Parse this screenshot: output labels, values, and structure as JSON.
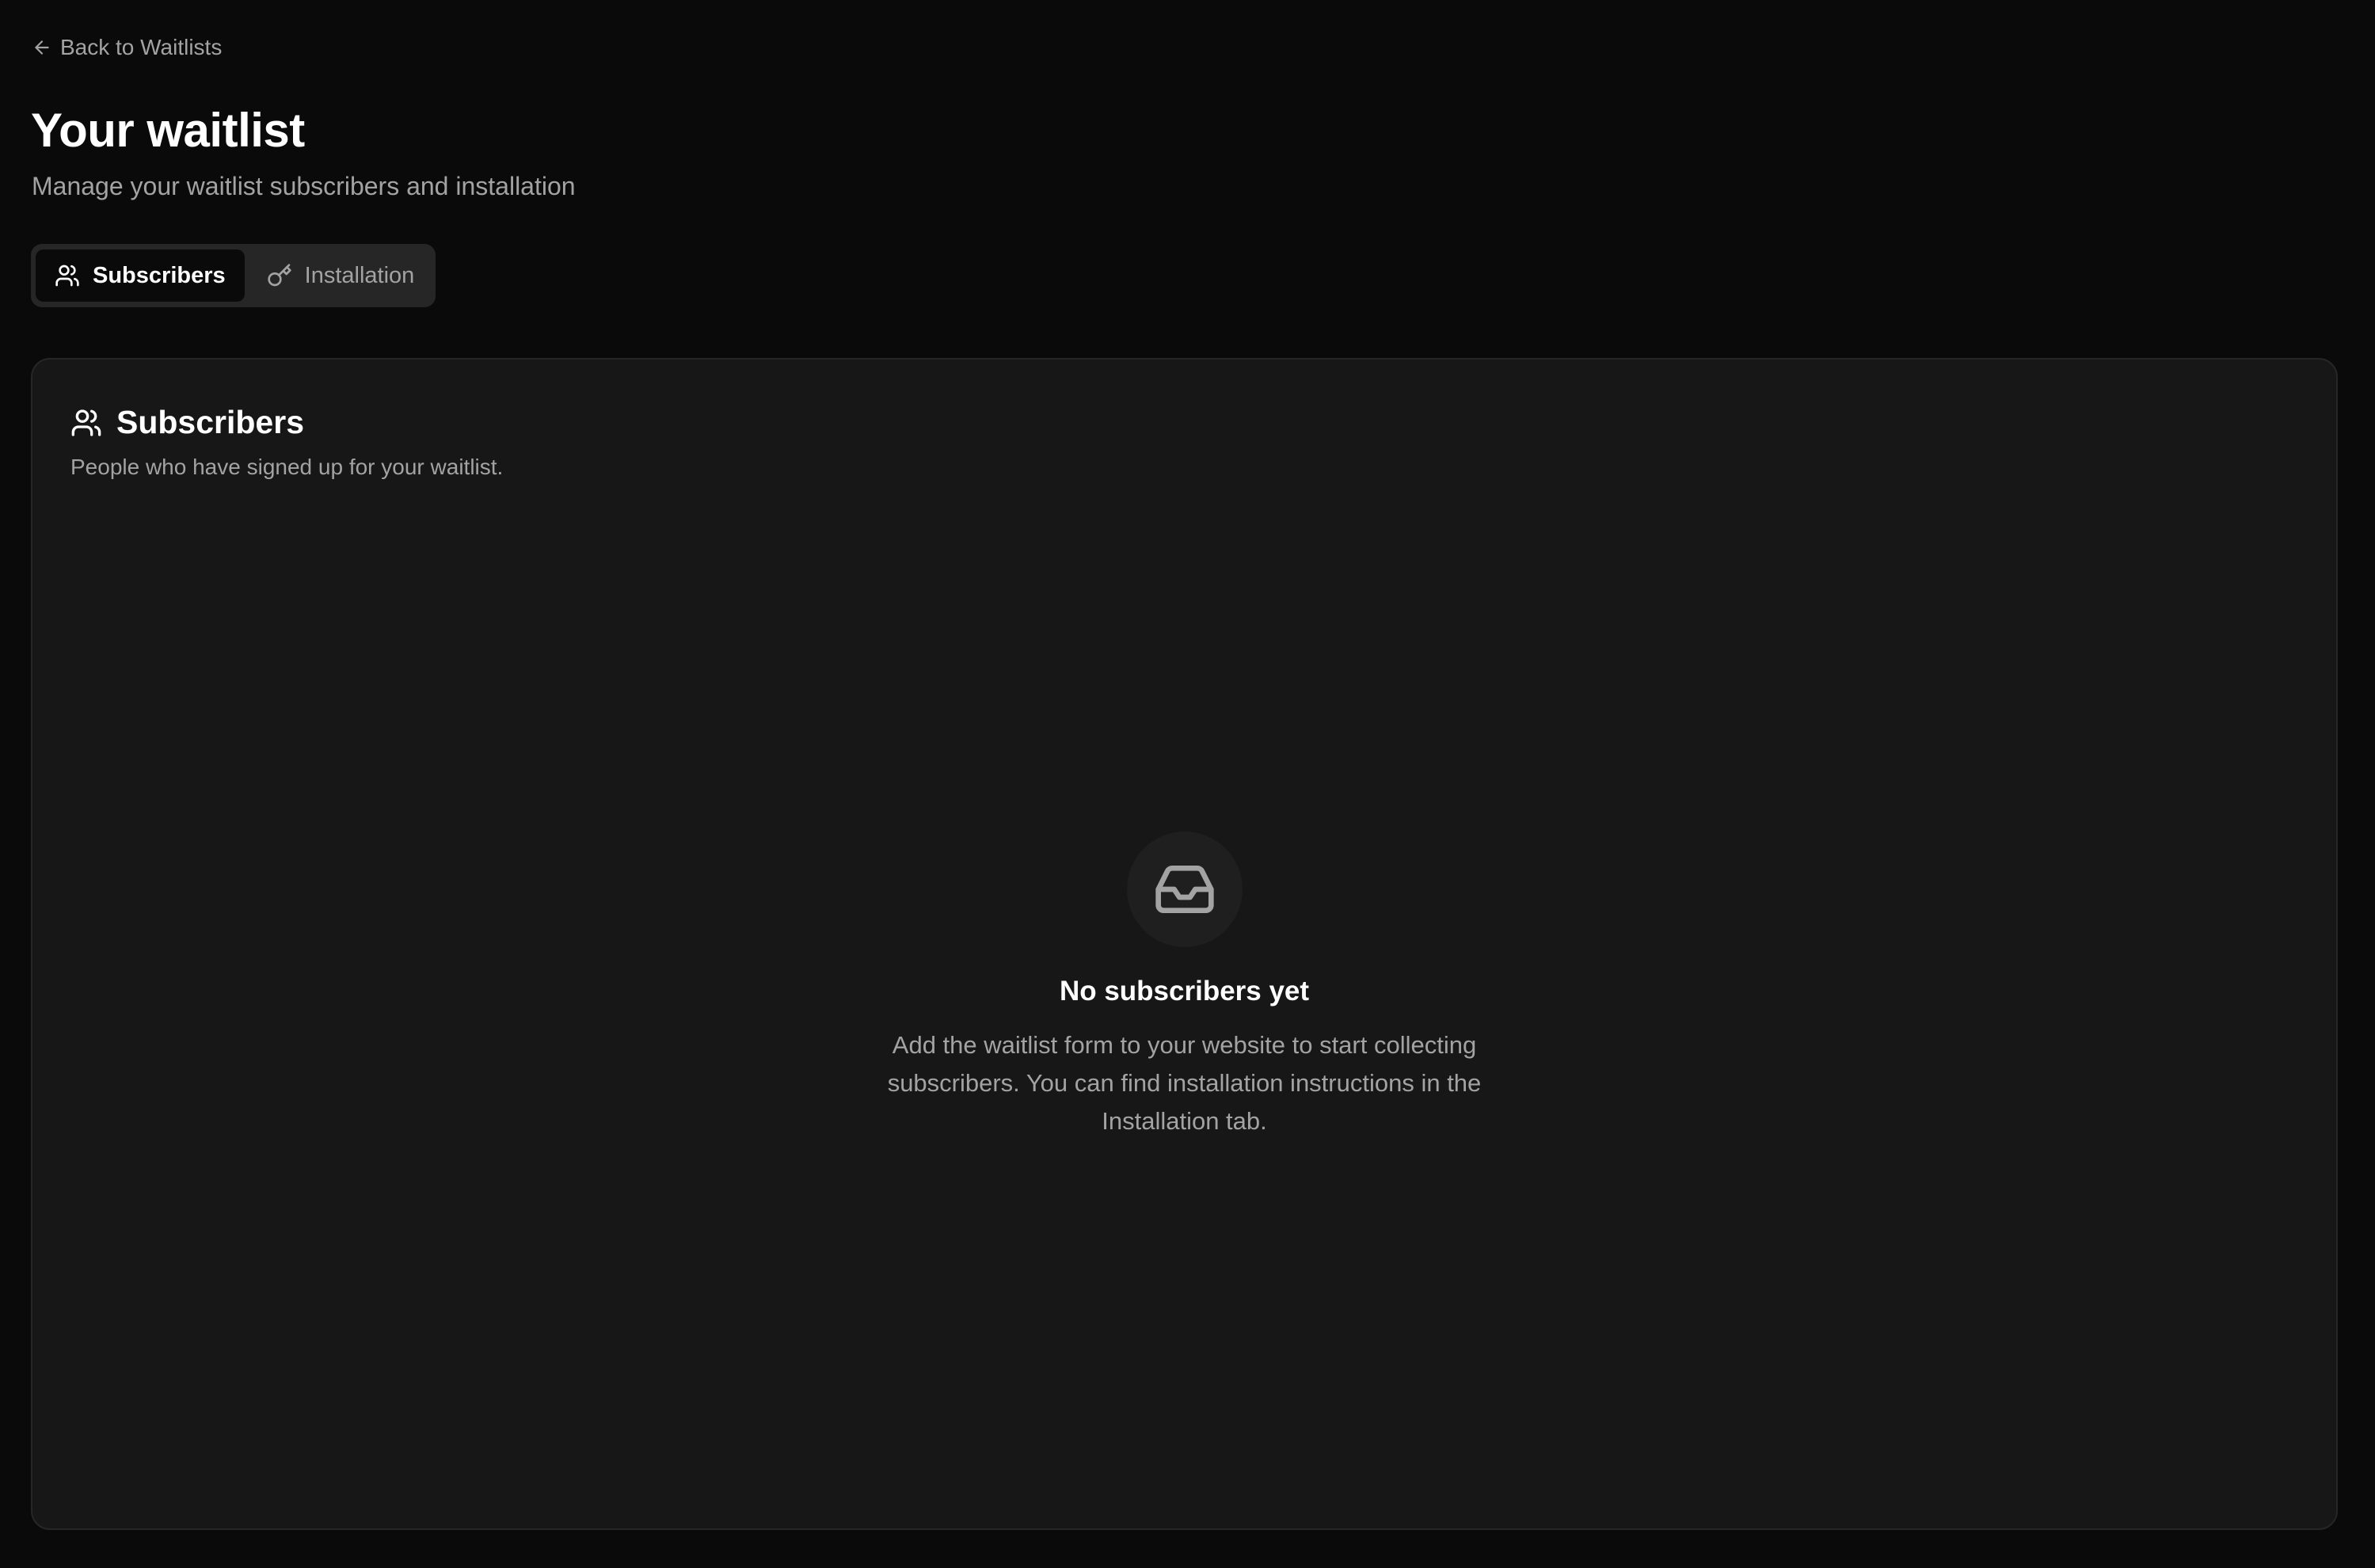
{
  "nav": {
    "back_label": "Back to Waitlists"
  },
  "header": {
    "title": "Your waitlist",
    "subtitle": "Manage your waitlist subscribers and installation"
  },
  "tabs": [
    {
      "label": "Subscribers",
      "icon": "users-icon",
      "active": true
    },
    {
      "label": "Installation",
      "icon": "key-icon",
      "active": false
    }
  ],
  "card": {
    "title": "Subscribers",
    "icon": "users-icon",
    "description": "People who have signed up for your waitlist.",
    "empty_state": {
      "icon": "inbox-icon",
      "title": "No subscribers yet",
      "message": "Add the waitlist form to your website to start collecting subscribers. You can find installation instructions in the Installation tab."
    }
  },
  "colors": {
    "background": "#0a0a0a",
    "card_background": "#171717",
    "card_border": "#262626",
    "text_primary": "#ffffff",
    "text_muted": "#a3a3a3"
  }
}
